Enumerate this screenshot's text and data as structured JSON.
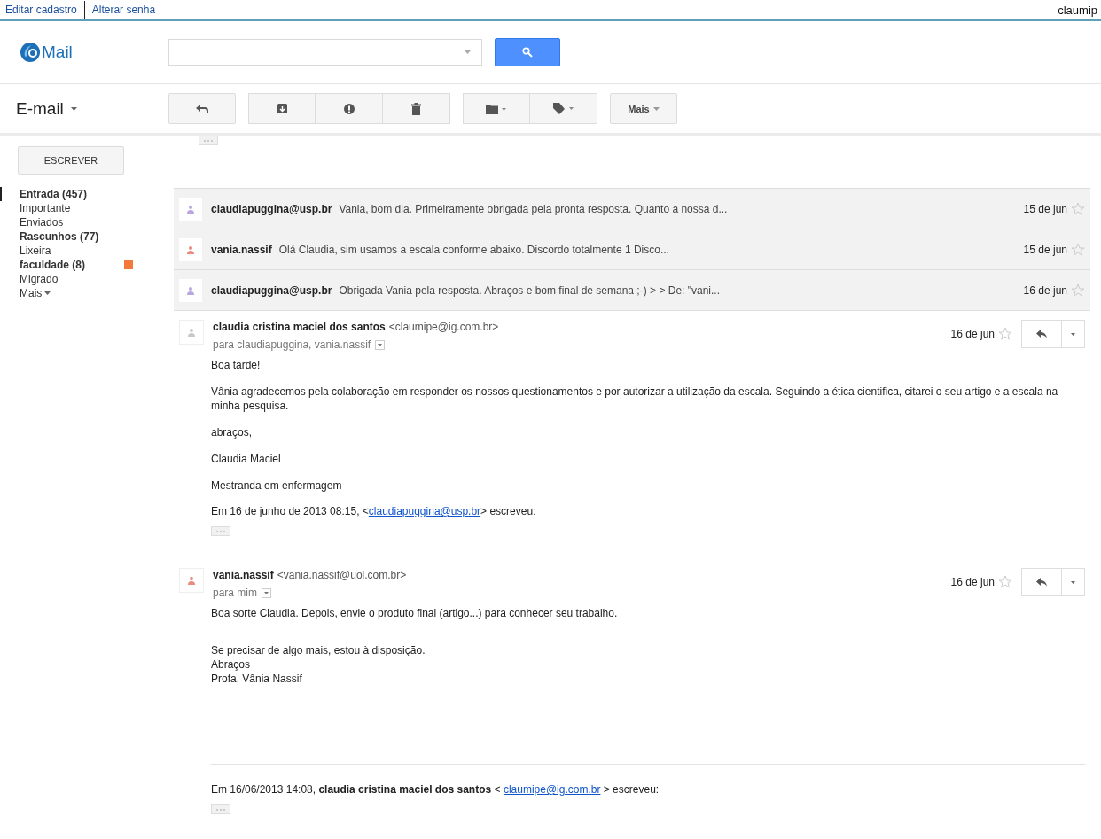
{
  "top_bar": {
    "links": [
      "Editar cadastro",
      "Alterar senha"
    ],
    "user": "claumip"
  },
  "logo": {
    "text": "Mail"
  },
  "app_title": "E-mail",
  "toolbar": {
    "more_label": "Mais"
  },
  "compose_button": "ESCREVER",
  "folders": [
    {
      "label": "Entrada (457)",
      "bold": true,
      "selected": true
    },
    {
      "label": "Importante",
      "bold": false,
      "selected": false
    },
    {
      "label": "Enviados",
      "bold": false,
      "selected": false
    },
    {
      "label": "Rascunhos (77)",
      "bold": true,
      "selected": false
    },
    {
      "label": "Lixeira",
      "bold": false,
      "selected": false
    },
    {
      "label": "faculdade (8)",
      "bold": true,
      "selected": false,
      "color": "#f4773b"
    },
    {
      "label": "Migrado",
      "bold": false,
      "selected": false
    },
    {
      "label": "Mais",
      "bold": false,
      "selected": false,
      "kind": "more"
    }
  ],
  "collapsed_messages": [
    {
      "sender": "claudiapuggina@usp.br",
      "snippet": "Vania, bom dia. Primeiramente obrigada pela pronta resposta. Quanto a nossa d...",
      "date": "15 de jun",
      "starred": false,
      "color": "#b9a6df"
    },
    {
      "sender": "vania.nassif",
      "snippet": "Olá Claudia, sim usamos a escala conforme abaixo. Discordo totalmente 1 Disco...",
      "date": "15 de jun",
      "starred": false,
      "color": "#e98a7e"
    },
    {
      "sender": "claudiapuggina@usp.br",
      "snippet": "Obrigada Vania pela resposta. Abraços e bom final de semana ;-) > > De: \"vani...",
      "date": "16 de jun",
      "starred": false,
      "color": "#b9a6df"
    }
  ],
  "messages": [
    {
      "sender": "claudia cristina maciel dos santos",
      "email": "<claumipe@ig.com.br>",
      "recipients": "para claudiapuggina, vania.nassif",
      "date": "16 de jun",
      "starred": false,
      "color": "#c8c8c8",
      "paragraphs": [
        [
          "Boa tarde!"
        ],
        [
          "Vânia agradecemos pela colaboração em responder os nossos questionamentos e por autorizar a utilização da escala. Seguindo a ética cientifica, citarei o seu artigo e a escala na minha pesquisa."
        ],
        [
          "abraços,"
        ],
        [
          "Claudia Maciel"
        ],
        [
          "Mestranda em enfermagem"
        ]
      ],
      "quote": {
        "rule_above": false,
        "before": "Em 16 de junho de 2013 08:15, <",
        "link": "claudiapuggina@usp.br",
        "after": "> escreveu:"
      }
    },
    {
      "sender": "vania.nassif",
      "email": "<vania.nassif@uol.com.br>",
      "recipients": "para mim",
      "date": "16 de jun",
      "starred": false,
      "color": "#e98a7e",
      "paragraphs": [
        [
          "Boa sorte Claudia. Depois, envie o produto final (artigo...) para conhecer seu trabalho."
        ],
        [
          "Se precisar de algo mais, estou à disposição.",
          "Abraços",
          "Profa. Vânia Nassif"
        ]
      ],
      "quote": {
        "rule_above": true,
        "before": "Em 16/06/2013 14:08, **claudia cristina maciel dos santos** < ",
        "link": "claumipe@ig.com.br",
        "after": " > escreveu:"
      }
    }
  ]
}
